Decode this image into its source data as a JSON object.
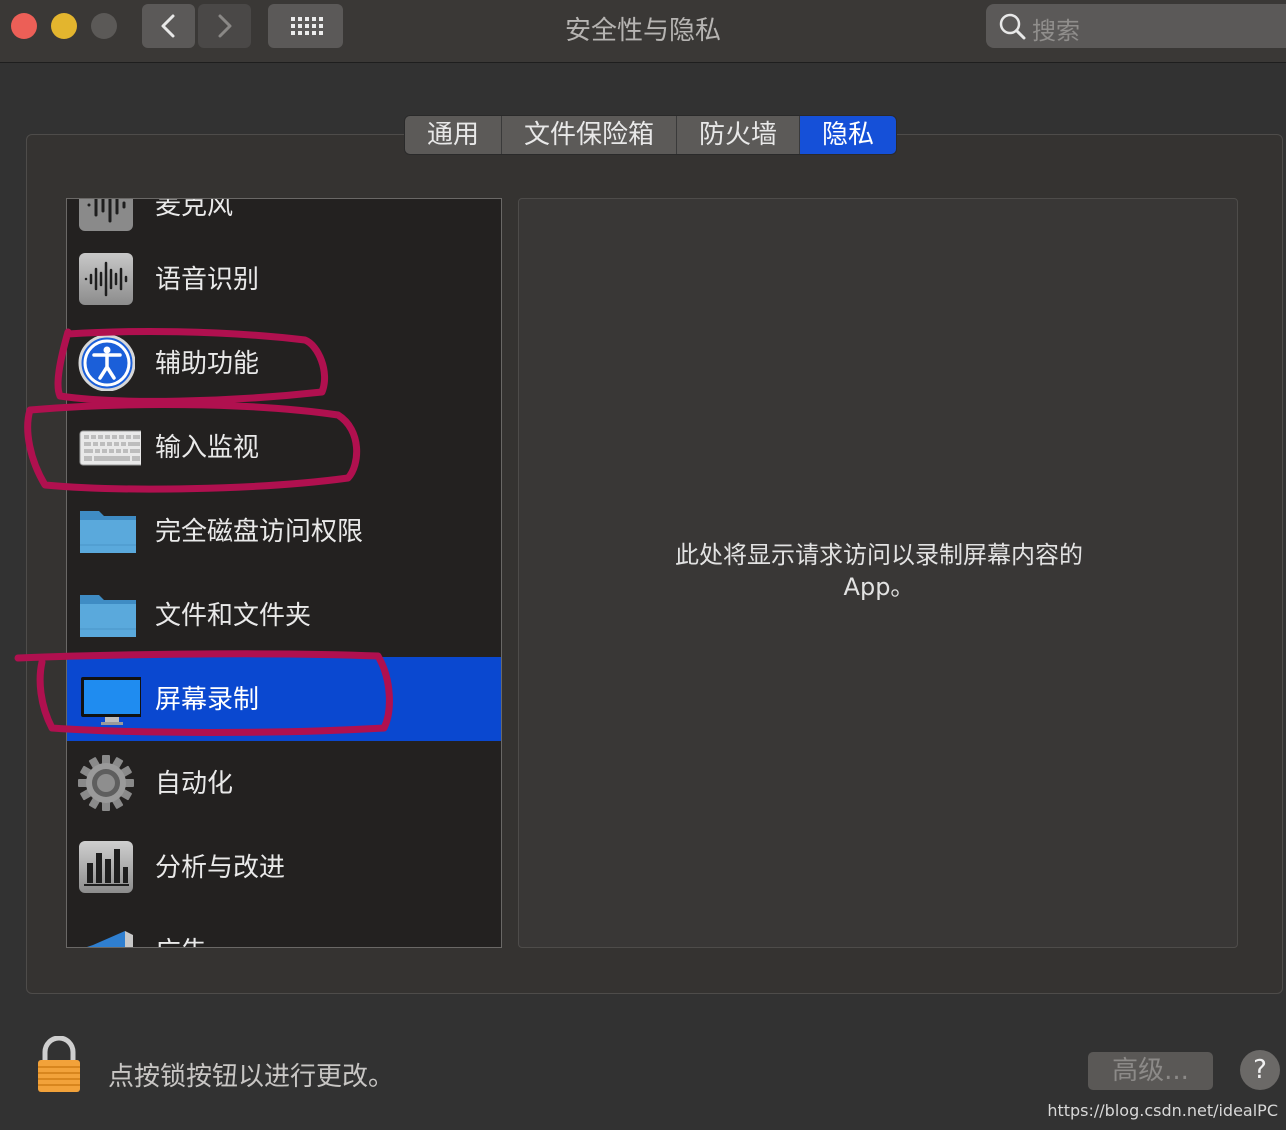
{
  "window": {
    "title": "安全性与隐私"
  },
  "search": {
    "placeholder": "搜索"
  },
  "tabs": [
    {
      "label": "通用",
      "active": false
    },
    {
      "label": "文件保险箱",
      "active": false
    },
    {
      "label": "防火墙",
      "active": false
    },
    {
      "label": "隐私",
      "active": true
    }
  ],
  "privacy_list": [
    {
      "label": "麦克风",
      "icon": "microphone-icon"
    },
    {
      "label": "语音识别",
      "icon": "waveform-icon"
    },
    {
      "label": "辅助功能",
      "icon": "accessibility-icon"
    },
    {
      "label": "输入监视",
      "icon": "keyboard-icon"
    },
    {
      "label": "完全磁盘访问权限",
      "icon": "folder-icon"
    },
    {
      "label": "文件和文件夹",
      "icon": "folder-icon"
    },
    {
      "label": "屏幕录制",
      "icon": "display-icon",
      "selected": true
    },
    {
      "label": "自动化",
      "icon": "gear-icon"
    },
    {
      "label": "分析与改进",
      "icon": "bar-chart-icon"
    },
    {
      "label": "广告",
      "icon": "megaphone-icon"
    }
  ],
  "detail": {
    "message": "此处将显示请求访问以录制屏幕内容的 App。"
  },
  "footer": {
    "lock_message": "点按锁按钮以进行更改。",
    "advanced_label": "高级...",
    "help_label": "?"
  },
  "watermark": "https://blog.csdn.net/idealPC",
  "colors": {
    "accent": "#0a48d0",
    "annotation": "#b0104f"
  }
}
